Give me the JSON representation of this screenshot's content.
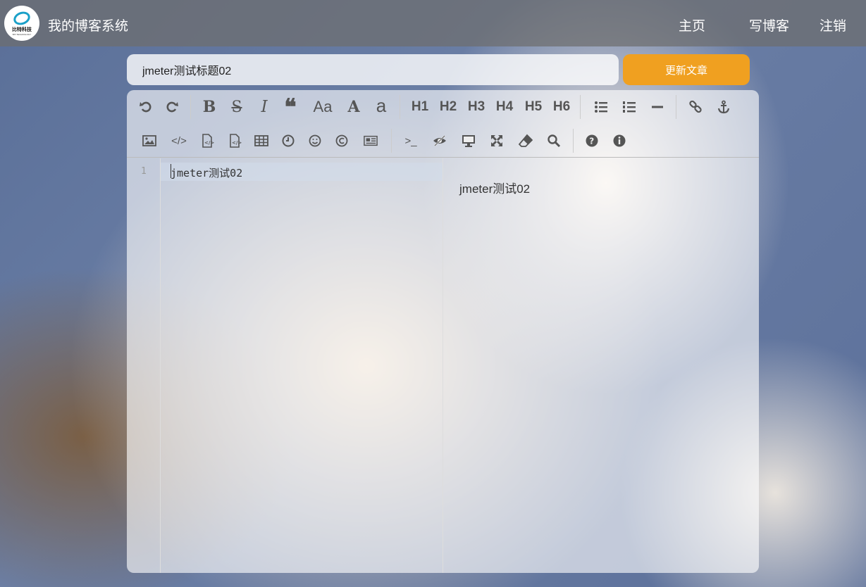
{
  "header": {
    "logo_text": "比特科技",
    "logo_sub": "BIT-TECHNOLOGY",
    "site_title": "我的博客系统",
    "nav": [
      {
        "label": "主页"
      },
      {
        "label": "写博客"
      },
      {
        "label": "注销"
      }
    ]
  },
  "editor_form": {
    "title_value": "jmeter测试标题02",
    "update_button": "更新文章"
  },
  "toolbar": {
    "headings": [
      "H1",
      "H2",
      "H3",
      "H4",
      "H5",
      "H6"
    ],
    "icons_row1": [
      "undo-icon",
      "redo-icon",
      "bold-icon",
      "strikethrough-icon",
      "italic-icon",
      "quote-icon",
      "uppercase-icon",
      "font-a-icon",
      "lowercase-icon",
      "h1-icon",
      "h2-icon",
      "h3-icon",
      "h4-icon",
      "h5-icon",
      "h6-icon",
      "unordered-list-icon",
      "ordered-list-icon",
      "horizontal-rule-icon",
      "link-icon",
      "anchor-icon"
    ],
    "icons_row2": [
      "image-icon",
      "code-icon",
      "code-file-icon",
      "code-block-icon",
      "table-icon",
      "clock-icon",
      "emoji-icon",
      "copyright-icon",
      "pagebreak-icon",
      "terminal-icon",
      "hide-preview-icon",
      "monitor-icon",
      "fullscreen-icon",
      "eraser-icon",
      "search-icon",
      "help-icon",
      "info-icon"
    ],
    "case_labels": {
      "upper": "Aa",
      "font": "A",
      "lower": "a"
    }
  },
  "markdown": {
    "line_numbers": [
      "1"
    ],
    "lines": [
      "jmeter测试02"
    ]
  },
  "preview": {
    "text": "jmeter测试02"
  }
}
